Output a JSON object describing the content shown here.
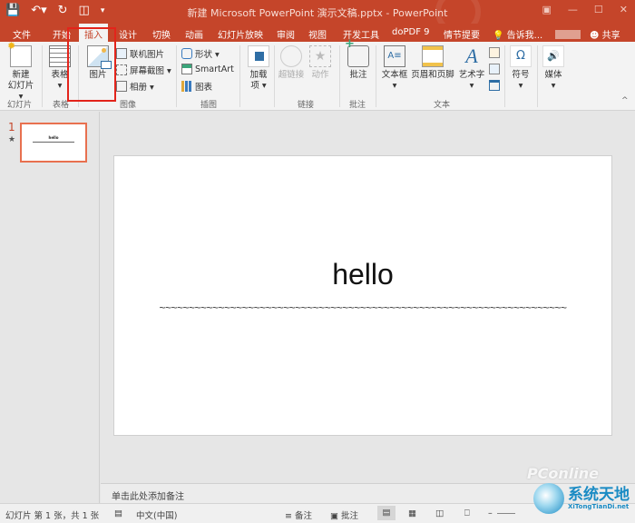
{
  "titlebar": {
    "title": "新建 Microsoft PowerPoint 演示文稿.pptx - PowerPoint",
    "qat": [
      "save-icon",
      "undo-icon",
      "redo-icon",
      "present-icon",
      "customize-icon"
    ],
    "window_controls": [
      "ribbon-display-icon",
      "minimize-icon",
      "maximize-icon",
      "close-icon"
    ]
  },
  "tabs": [
    {
      "label": "文件"
    },
    {
      "label": "开始"
    },
    {
      "label": "插入",
      "active": true
    },
    {
      "label": "设计"
    },
    {
      "label": "切换"
    },
    {
      "label": "动画"
    },
    {
      "label": "幻灯片放映"
    },
    {
      "label": "审阅"
    },
    {
      "label": "视图"
    },
    {
      "label": "开发工具"
    },
    {
      "label": "doPDF 9"
    },
    {
      "label": "情节提要"
    }
  ],
  "tell_me": "告诉我...",
  "share": "共享",
  "ribbon": {
    "groups": {
      "slides": "幻灯片",
      "tables": "表格",
      "images": "图像",
      "illustrations": "插图",
      "links": "链接",
      "comments": "批注",
      "text": "文本"
    },
    "new_slide": [
      "新建",
      "幻灯片 ▾"
    ],
    "table": [
      "表格",
      "▾"
    ],
    "picture": "图片",
    "online_pictures": "联机图片",
    "screenshot": "屏幕截图 ▾",
    "album": "相册  ▾",
    "shapes": "形状 ▾",
    "smartart": "SmartArt",
    "chart": "图表",
    "addins": [
      "加载",
      "项 ▾"
    ],
    "hyperlink": "超链接",
    "action": "动作",
    "comment": "批注",
    "textbox": [
      "文本框",
      "▾"
    ],
    "header_footer": "页眉和页脚",
    "wordart": [
      "艺术字",
      "▾"
    ],
    "symbols": [
      "符号",
      "▾"
    ],
    "media": [
      "媒体",
      "▾"
    ],
    "collapse": "^"
  },
  "slides_pane": {
    "number": "1",
    "star": "★",
    "thumb_title": "hello"
  },
  "slide": {
    "title": "hello",
    "subtitle": "~~~~~~~~~~~~~~~~~~~~~~~~~~~~~~~~~~~~~~~~~~~~~~~~~~~~~~~~~~~~~~~~~~~~~"
  },
  "notes_placeholder": "单击此处添加备注",
  "statusbar": {
    "slide_info": "幻灯片 第 1 张，共 1 张",
    "language": "中文(中国)",
    "notes": "备注",
    "comments": "批注"
  },
  "watermarks": {
    "pconline": "PConline",
    "site_name": "系统天地",
    "site_url": "XiTongTianDi.net"
  },
  "colors": {
    "accent": "#c5452a",
    "highlight_box": "#e3241b",
    "thumb_border": "#e8704f"
  }
}
